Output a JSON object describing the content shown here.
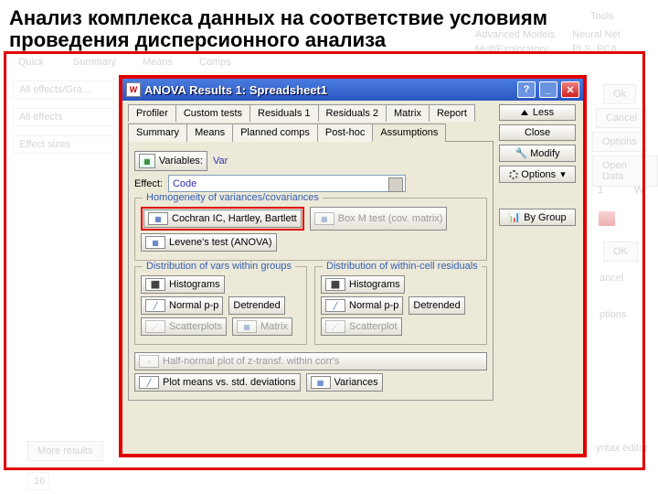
{
  "slide_title": "Анализ комплекса данных на соответствие условиям проведения дисперсионного анализа",
  "window": {
    "title": "ANOVA Results 1: Spreadsheet1",
    "tabs_top": [
      "Profiler",
      "Custom tests",
      "Residuals 1",
      "Residuals 2",
      "Matrix",
      "Report"
    ],
    "tabs_bottom": [
      "Summary",
      "Means",
      "Planned comps",
      "Post-hoc",
      "Assumptions"
    ],
    "variables_btn": "Variables:",
    "variables_value": "Var",
    "effect_label": "Effect:",
    "effect_value": "Code",
    "side": {
      "less": "Less",
      "close": "Close",
      "modify": "Modify",
      "options": "Options",
      "bygroup": "By Group"
    },
    "homog": {
      "title": "Homogeneity of variances/covariances",
      "cochran": "Cochran IC, Hartley, Bartlett",
      "boxm": "Box M test (cov. matrix)",
      "levene": "Levene's test (ANOVA)"
    },
    "dist_vars": {
      "title": "Distribution of vars within groups",
      "hist": "Histograms",
      "normpp": "Normal p-p",
      "detr": "Detrended",
      "scat": "Scatterplots",
      "matrix": "Matrix"
    },
    "dist_resid": {
      "title": "Distribution of within-cell residuals",
      "hist": "Histograms",
      "normpp": "Normal p-p",
      "detr": "Detrended",
      "scat": "Scatterplot"
    },
    "halfnorm": "Half-normal plot of z-transf. within corr's",
    "plotmeans": "Plot means vs. std. deviations",
    "variances_btn": "Variances"
  },
  "bg": {
    "tools": "Tools",
    "advanced": "Advanced Models",
    "neural": "Neural Net",
    "multiexp": "Mult/Exploratory",
    "pls": "PLS, PCA",
    "quick": "Quick",
    "summary": "Summary",
    "means": "Means",
    "comps": "Comps",
    "all_effects_gra": "All effects/Gra...",
    "all_effects": "All effects",
    "effect_sizes": "Effect sizes",
    "more_results": "More results",
    "ok": "Ok",
    "ok2": "OK",
    "cancel": "Cancel",
    "cancel2": "ancel",
    "options": "Options",
    "options2": "ptions",
    "open_data": "Open Data",
    "syntax": "yntax editor",
    "n16": "16",
    "w": "W",
    "one": "1"
  }
}
